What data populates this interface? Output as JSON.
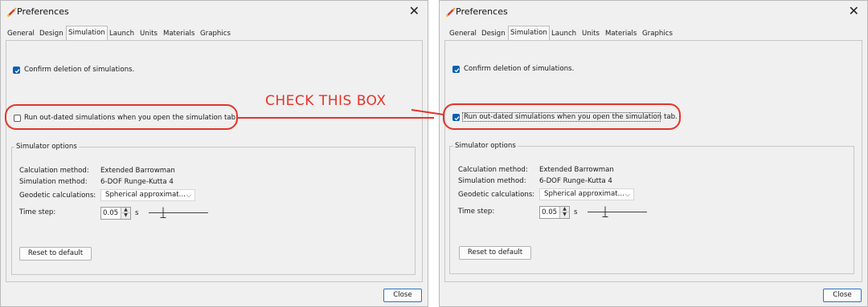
{
  "window": {
    "title": "Preferences",
    "close_glyph": "✕"
  },
  "tabs": [
    "General",
    "Design",
    "Simulation",
    "Launch",
    "Units",
    "Materials",
    "Graphics"
  ],
  "active_tab": "Simulation",
  "confirm_deletion": {
    "label": "Confirm deletion of simulations.",
    "checked": true
  },
  "run_outdated": {
    "label": "Run out-dated simulations when you open the simulation tab."
  },
  "before": {
    "run_outdated_checked": false
  },
  "after": {
    "run_outdated_checked": true
  },
  "simulator_options": {
    "title": "Simulator options",
    "calc_method_label": "Calculation method:",
    "calc_method_value": "Extended Barrowman",
    "sim_method_label": "Simulation method:",
    "sim_method_value": "6-DOF Runge-Kutta 4",
    "geodetic_label": "Geodetic calculations:",
    "geodetic_value": "Spherical approximat...",
    "time_step_label": "Time step:",
    "time_step_value": "0.05",
    "time_step_unit": "s",
    "reset_button": "Reset to default"
  },
  "close_button": "Close",
  "annotation": {
    "text": "CHECK THIS BOX",
    "color": "#e5332a"
  },
  "icons": {
    "app": "rocket-icon",
    "checkmark": "checkmark-icon",
    "dropdown": "chevron-down-icon",
    "spin_up": "triangle-up-icon",
    "spin_down": "triangle-down-icon"
  },
  "colors": {
    "checkbox_on": "#0a5fb4",
    "close_button_border": "#2a73c9",
    "annotation": "#e5332a"
  }
}
